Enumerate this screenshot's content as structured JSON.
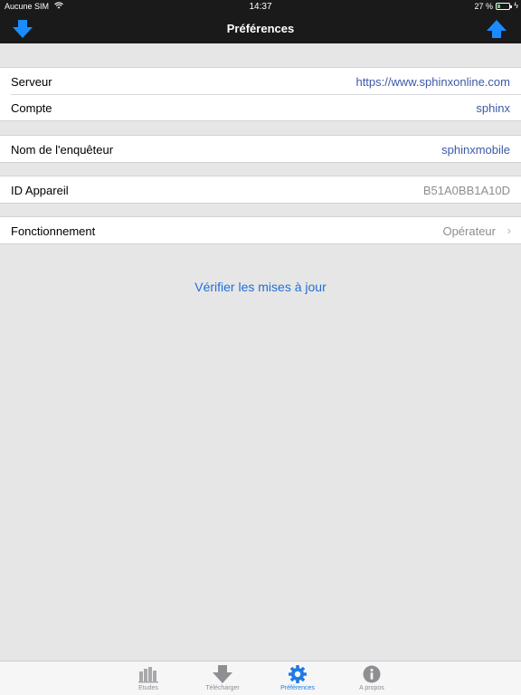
{
  "status_bar": {
    "carrier": "Aucune SIM",
    "time": "14:37",
    "battery_percent": "27 %",
    "battery_level": 0.27
  },
  "nav_bar": {
    "title": "Préférences",
    "left_icon": "download-arrow-icon",
    "right_icon": "upload-arrow-icon"
  },
  "settings": {
    "server": {
      "label": "Serveur",
      "value": "https://www.sphinxonline.com"
    },
    "account": {
      "label": "Compte",
      "value": "sphinx"
    },
    "surveyor": {
      "label": "Nom de l'enquêteur",
      "value": "sphinxmobile"
    },
    "device": {
      "label": "ID Appareil",
      "value": "B51A0BB1A10D"
    },
    "mode": {
      "label": "Fonctionnement",
      "value": "Opérateur"
    }
  },
  "update_link": "Vérifier les mises à jour",
  "tabs": [
    {
      "label": "Etudes",
      "icon": "bar-chart-icon"
    },
    {
      "label": "Télécharger",
      "icon": "download-icon"
    },
    {
      "label": "Préférences",
      "icon": "gear-icon",
      "active": true
    },
    {
      "label": "A propos",
      "icon": "info-icon"
    }
  ],
  "colors": {
    "accent": "#1f7ae6",
    "value_text": "#3b5aa6",
    "bar_background": "#1a1a1a",
    "arrow_blue": "#1a8cff"
  }
}
